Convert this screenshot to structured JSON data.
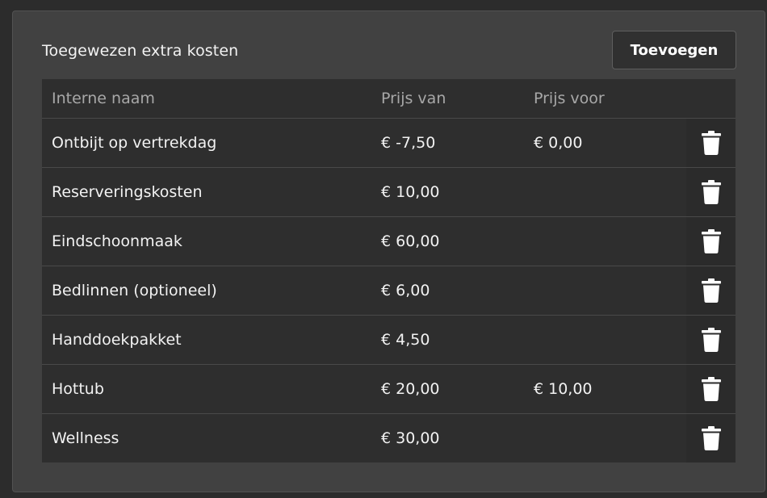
{
  "panel": {
    "title": "Toegewezen extra kosten",
    "add_label": "Toevoegen"
  },
  "table": {
    "headers": {
      "name": "Interne naam",
      "price_from": "Prijs van",
      "price_to": "Prijs voor"
    },
    "rows": [
      {
        "name": "Ontbijt op vertrekdag",
        "price_from": "€ -7,50",
        "price_to": "€ 0,00",
        "action_icon": "trash-icon"
      },
      {
        "name": "Reserveringskosten",
        "price_from": "€ 10,00",
        "price_to": "",
        "action_icon": "trash-icon"
      },
      {
        "name": "Eindschoonmaak",
        "price_from": "€ 60,00",
        "price_to": "",
        "action_icon": "trash-icon"
      },
      {
        "name": "Bedlinnen (optioneel)",
        "price_from": "€ 6,00",
        "price_to": "",
        "action_icon": "trash-icon"
      },
      {
        "name": "Handdoekpakket",
        "price_from": "€ 4,50",
        "price_to": "",
        "action_icon": "trash-icon"
      },
      {
        "name": "Hottub",
        "price_from": "€ 20,00",
        "price_to": "€ 10,00",
        "action_icon": "trash-icon"
      },
      {
        "name": "Wellness",
        "price_from": "€ 30,00",
        "price_to": "",
        "action_icon": "trash-icon"
      }
    ]
  },
  "colors": {
    "background": "#2c2c2c",
    "panel": "#414141",
    "row": "#2e2e2e",
    "text": "#f2f2f2",
    "header_text": "#a8a8a8"
  }
}
